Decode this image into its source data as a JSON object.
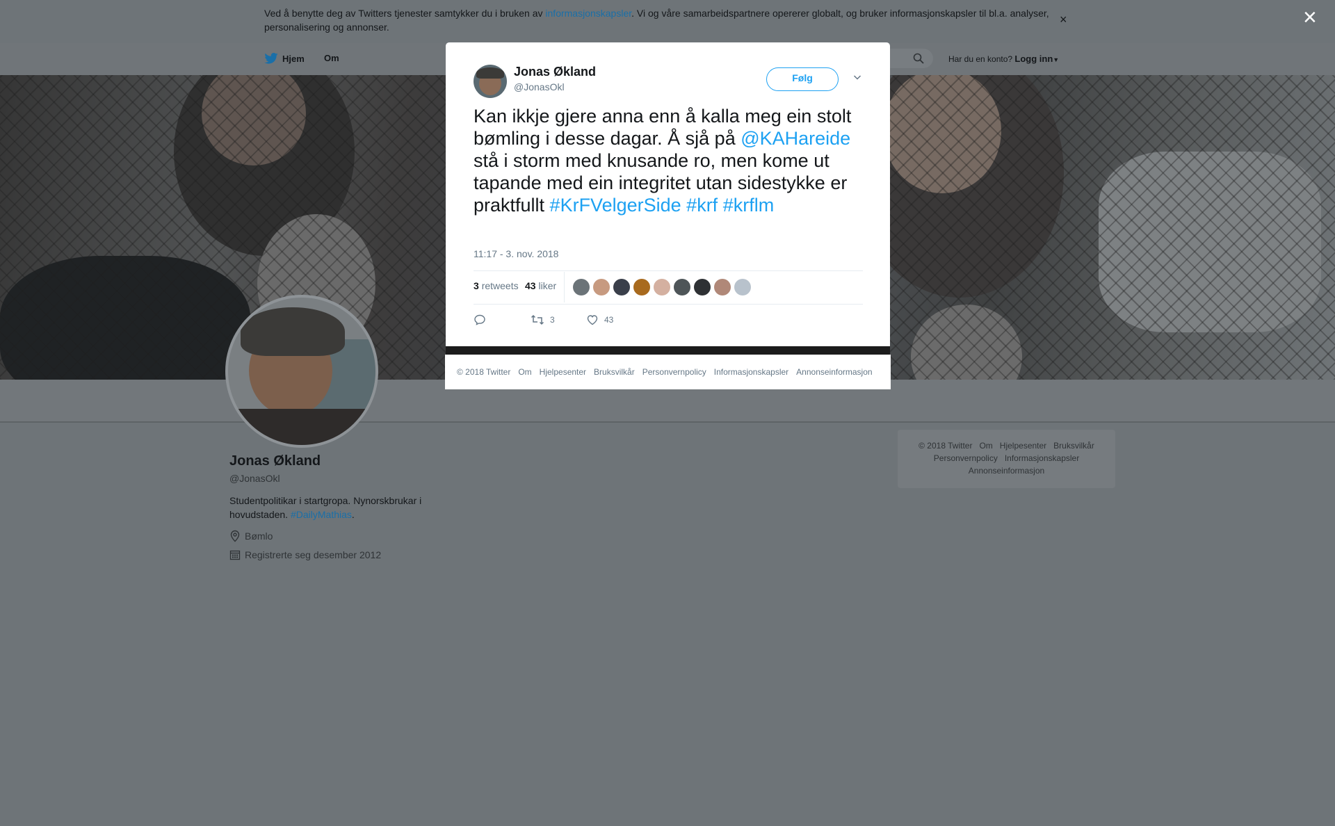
{
  "cookie_banner": {
    "text_before": "Ved å benytte deg av Twitters tjenester samtykker du i bruken av ",
    "link": "informasjonskapsler",
    "text_after": ". Vi og våre samarbeidspartnere opererer globalt, og bruker informasjonskapsler til bl.a. analyser, personalisering og annonser.",
    "close_glyph": "×"
  },
  "overlay_close_glyph": "×",
  "nav": {
    "home": "Hjem",
    "about": "Om",
    "login_prompt": "Har du en konto?",
    "login": "Logg inn"
  },
  "profile": {
    "name": "Jonas Økland",
    "handle": "@JonasOkl",
    "bio_text": "Studentpolitikar i startgropa. Nynorskbrukar i hovudstaden. ",
    "bio_hashtag": "#DailyMathias",
    "bio_end": ".",
    "location": "Bømlo",
    "joined": "Registrerte seg desember 2012"
  },
  "side_footer": {
    "row1": [
      "© 2018 Twitter",
      "Om",
      "Hjelpesenter",
      "Bruksvilkår"
    ],
    "row2": [
      "Personvernpolicy",
      "Informasjonskapsler"
    ],
    "row3": [
      "Annonseinformasjon"
    ]
  },
  "tweet": {
    "author_name": "Jonas Økland",
    "author_handle": "@JonasOkl",
    "follow_label": "Følg",
    "text_1": "Kan ikkje gjere anna enn å kalla meg ein stolt bømling i desse dagar. Å sjå  på ",
    "mention": "@KAHareide",
    "text_2": " stå i storm med knusande ro, men kome ut tapande med ein integritet utan sidestykke er praktfullt ",
    "hashtag_1": "#KrFVelgerSide",
    "hashtag_2": "#krf",
    "hashtag_3": "#krflm",
    "timestamp": "11:17 - 3. nov. 2018",
    "retweet_count": "3",
    "retweet_label": "retweets",
    "like_count": "43",
    "like_label": "liker",
    "action_retweets": "3",
    "action_likes": "43",
    "liker_colors": [
      "#6b7378",
      "#c79a80",
      "#3a3f4a",
      "#a86a1e",
      "#d4b0a0",
      "#4e5558",
      "#2e3134",
      "#b08878",
      "#b8c2cc"
    ]
  },
  "modal_footer": [
    "© 2018 Twitter",
    "Om",
    "Hjelpesenter",
    "Bruksvilkår",
    "Personvernpolicy",
    "Informasjonskapsler",
    "Annonseinformasjon"
  ]
}
